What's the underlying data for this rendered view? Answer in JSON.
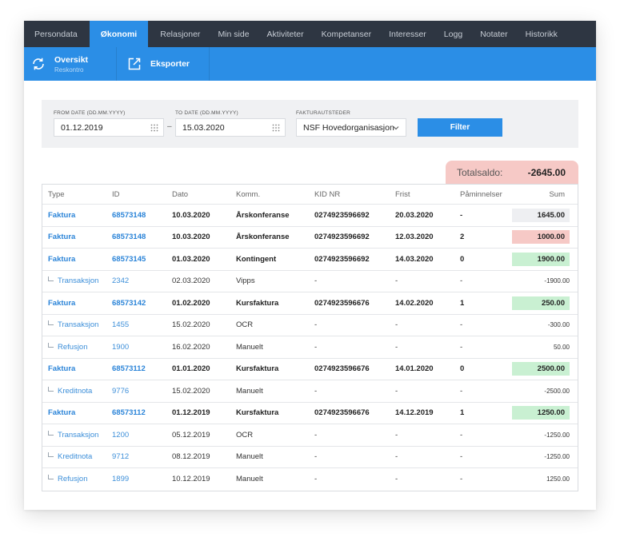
{
  "topnav": {
    "tabs": [
      {
        "label": "Persondata",
        "active": false
      },
      {
        "label": "Økonomi",
        "active": true
      },
      {
        "label": "Relasjoner",
        "active": false
      },
      {
        "label": "Min side",
        "active": false
      },
      {
        "label": "Aktiviteter",
        "active": false
      },
      {
        "label": "Kompetanser",
        "active": false
      },
      {
        "label": "Interesser",
        "active": false
      },
      {
        "label": "Logg",
        "active": false
      },
      {
        "label": "Notater",
        "active": false
      },
      {
        "label": "Historikk",
        "active": false
      }
    ]
  },
  "subnav": {
    "overview_title": "Oversikt",
    "overview_subtitle": "Reskontro",
    "overview_icon": "refresh-icon",
    "export_label": "Eksporter",
    "export_icon": "external-link-icon"
  },
  "filter": {
    "from_label": "FROM DATE (DD.MM.YYYY)",
    "from_value": "01.12.2019",
    "separator": "–",
    "to_label": "TO DATE (DD.MM.YYYY)",
    "to_value": "15.03.2020",
    "issuer_label": "FAKTURAUTSTEDER",
    "issuer_value": "NSF Hovedorganisasjon",
    "filter_button": "Filter"
  },
  "total": {
    "label": "Totalsaldo:",
    "value": "-2645.00",
    "color": "#f6c9c6"
  },
  "table": {
    "headers": {
      "type": "Type",
      "id": "ID",
      "date": "Dato",
      "komm": "Komm.",
      "kid": "KID NR",
      "frist": "Frist",
      "pam": "Påminnelser",
      "sum": "Sum"
    },
    "rows": [
      {
        "kind": "main",
        "type": "Faktura",
        "id": "68573148",
        "date": "10.03.2020",
        "komm": "Årskonferanse",
        "kid": "0274923596692",
        "frist": "20.03.2020",
        "pam": "-",
        "sum": "1645.00",
        "badge": "#eeeff2"
      },
      {
        "kind": "main",
        "type": "Faktura",
        "id": "68573148",
        "date": "10.03.2020",
        "komm": "Årskonferanse",
        "kid": "0274923596692",
        "frist": "12.03.2020",
        "pam": "2",
        "sum": "1000.00",
        "badge": "#f6c9c6"
      },
      {
        "kind": "main",
        "type": "Faktura",
        "id": "68573145",
        "date": "01.03.2020",
        "komm": "Kontingent",
        "kid": "0274923596692",
        "frist": "14.03.2020",
        "pam": "0",
        "sum": "1900.00",
        "badge": "#c9f0d2"
      },
      {
        "kind": "sub",
        "type": "Transaksjon",
        "id": "2342",
        "date": "02.03.2020",
        "komm": "Vipps",
        "kid": "-",
        "frist": "-",
        "pam": "-",
        "sum": "-1900.00"
      },
      {
        "kind": "main",
        "type": "Faktura",
        "id": "68573142",
        "date": "01.02.2020",
        "komm": "Kursfaktura",
        "kid": "0274923596676",
        "frist": "14.02.2020",
        "pam": "1",
        "sum": "250.00",
        "badge": "#c9f0d2"
      },
      {
        "kind": "sub",
        "type": "Transaksjon",
        "id": "1455",
        "date": "15.02.2020",
        "komm": "OCR",
        "kid": "-",
        "frist": "-",
        "pam": "-",
        "sum": "-300.00"
      },
      {
        "kind": "sub",
        "type": "Refusjon",
        "id": "1900",
        "date": "16.02.2020",
        "komm": "Manuelt",
        "kid": "-",
        "frist": "-",
        "pam": "-",
        "sum": "50.00"
      },
      {
        "kind": "main",
        "type": "Faktura",
        "id": "68573112",
        "date": "01.01.2020",
        "komm": "Kursfaktura",
        "kid": "0274923596676",
        "frist": "14.01.2020",
        "pam": "0",
        "sum": "2500.00",
        "badge": "#c9f0d2"
      },
      {
        "kind": "sub",
        "type": "Kreditnota",
        "id": "9776",
        "date": "15.02.2020",
        "komm": "Manuelt",
        "kid": "-",
        "frist": "-",
        "pam": "-",
        "sum": "-2500.00"
      },
      {
        "kind": "main",
        "type": "Faktura",
        "id": "68573112",
        "date": "01.12.2019",
        "komm": "Kursfaktura",
        "kid": "0274923596676",
        "frist": "14.12.2019",
        "pam": "1",
        "sum": "1250.00",
        "badge": "#c9f0d2"
      },
      {
        "kind": "sub",
        "type": "Transaksjon",
        "id": "1200",
        "date": "05.12.2019",
        "komm": "OCR",
        "kid": "-",
        "frist": "-",
        "pam": "-",
        "sum": "-1250.00"
      },
      {
        "kind": "sub",
        "type": "Kreditnota",
        "id": "9712",
        "date": "08.12.2019",
        "komm": "Manuelt",
        "kid": "-",
        "frist": "-",
        "pam": "-",
        "sum": "-1250.00"
      },
      {
        "kind": "sub",
        "type": "Refusjon",
        "id": "1899",
        "date": "10.12.2019",
        "komm": "Manuelt",
        "kid": "-",
        "frist": "-",
        "pam": "-",
        "sum": "1250.00"
      }
    ]
  }
}
